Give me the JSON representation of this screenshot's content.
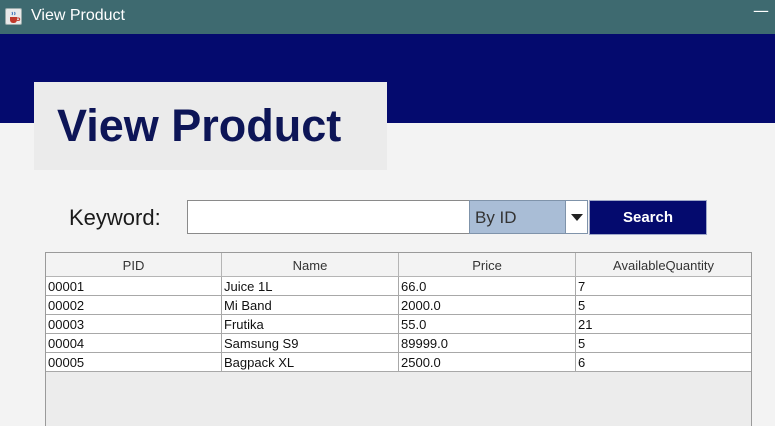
{
  "window": {
    "title": "View Product",
    "app_icon": "java-coffee-cup-icon",
    "minimize_glyph": "—"
  },
  "colors": {
    "titlebar": "#3e6a70",
    "banner": "#040a6e",
    "heading_text": "#0d1557",
    "combo_bg": "#a9bdd6",
    "search_button_bg": "#040a6e"
  },
  "header": {
    "heading": "View Product"
  },
  "search": {
    "keyword_label": "Keyword:",
    "keyword_value": "",
    "mode_selected": "By ID",
    "button_label": "Search"
  },
  "table": {
    "columns": [
      "PID",
      "Name",
      "Price",
      "AvailableQuantity"
    ],
    "rows": [
      [
        "00001",
        "Juice 1L",
        "66.0",
        "7"
      ],
      [
        "00002",
        "Mi Band",
        "2000.0",
        "5"
      ],
      [
        "00003",
        "Frutika",
        "55.0",
        "21"
      ],
      [
        "00004",
        "Samsung S9",
        "89999.0",
        "5"
      ],
      [
        "00005",
        "Bagpack XL",
        "2500.0",
        "6"
      ]
    ]
  }
}
